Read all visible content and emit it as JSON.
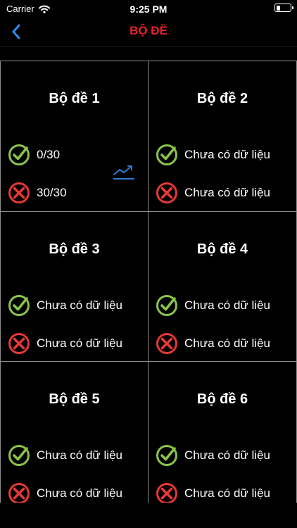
{
  "status_bar": {
    "carrier": "Carrier",
    "time": "9:25 PM"
  },
  "nav": {
    "title": "BỘ ĐỀ"
  },
  "colors": {
    "accent_red": "#e8222a",
    "correct_green": "#8bc34a",
    "wrong_red": "#e53935",
    "trend_blue": "#2d7fd3"
  },
  "sets": [
    {
      "title": "Bộ đề 1",
      "correct": "0/30",
      "wrong": "30/30",
      "show_trend": true
    },
    {
      "title": "Bộ đề 2",
      "correct": "Chưa có dữ liệu",
      "wrong": "Chưa có dữ liệu",
      "show_trend": false
    },
    {
      "title": "Bộ đề 3",
      "correct": "Chưa có dữ liệu",
      "wrong": "Chưa có dữ liệu",
      "show_trend": false
    },
    {
      "title": "Bộ đề 4",
      "correct": "Chưa có dữ liệu",
      "wrong": "Chưa có dữ liệu",
      "show_trend": false
    },
    {
      "title": "Bộ đề 5",
      "correct": "Chưa có dữ liệu",
      "wrong": "Chưa có dữ liệu",
      "show_trend": false
    },
    {
      "title": "Bộ đề 6",
      "correct": "Chưa có dữ liệu",
      "wrong": "Chưa có dữ liệu",
      "show_trend": false
    }
  ]
}
